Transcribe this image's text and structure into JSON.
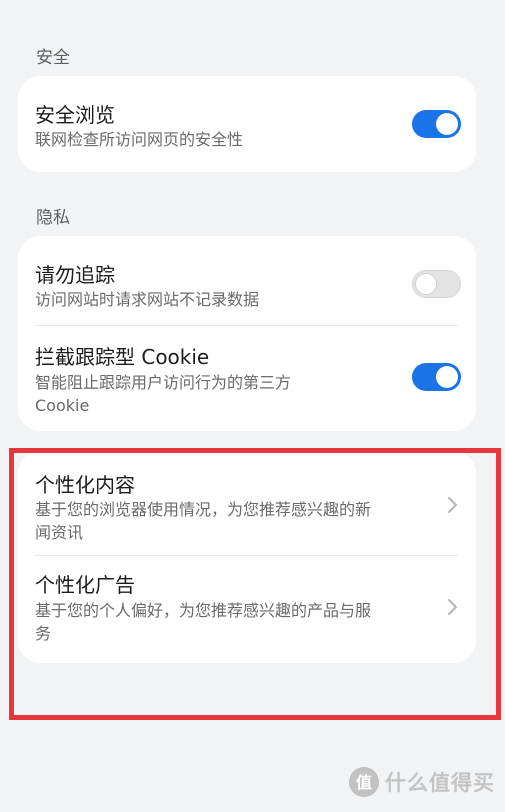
{
  "sections": {
    "security": {
      "label": "安全",
      "items": [
        {
          "title": "安全浏览",
          "subtitle": "联网检查所访问网页的安全性",
          "toggle": true
        }
      ]
    },
    "privacy": {
      "label": "隐私",
      "items": [
        {
          "title": "请勿追踪",
          "subtitle": "访问网站时请求网站不记录数据",
          "toggle": false
        },
        {
          "title": "拦截跟踪型 Cookie",
          "subtitle_line1": "智能阻止跟踪用户访问行为的第三方",
          "subtitle_line2": "Cookie",
          "toggle": true
        }
      ]
    },
    "personalization": {
      "items": [
        {
          "title": "个性化内容",
          "subtitle_line1": "基于您的浏览器使用情况，为您推荐感兴趣的新",
          "subtitle_line2": "闻资讯",
          "icon": "chevron-right-icon"
        },
        {
          "title": "个性化广告",
          "subtitle_line1": "基于您的个人偏好，为您推荐感兴趣的产品与服",
          "subtitle_line2": "务",
          "icon": "chevron-right-icon"
        }
      ]
    }
  },
  "colors": {
    "toggle_on": "#1a73e8",
    "highlight_border": "#e8373c"
  },
  "watermark": {
    "icon": "smzdm-logo-icon",
    "text": "什么值得买"
  }
}
